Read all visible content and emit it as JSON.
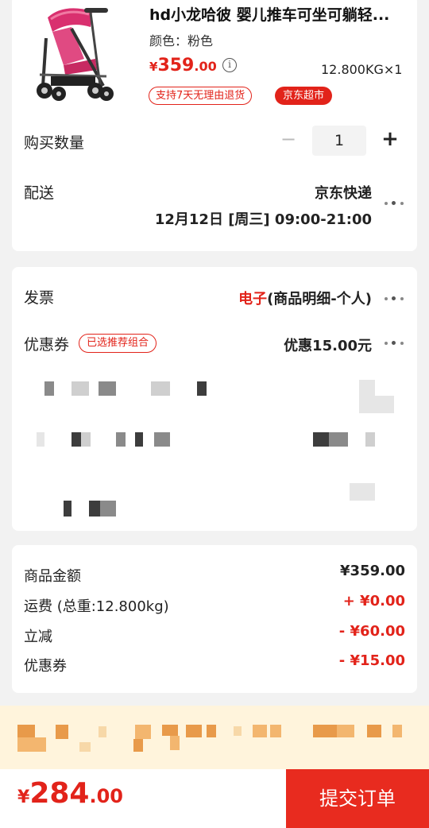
{
  "product": {
    "title": "hd小龙哈彼 婴儿推车可坐可躺轻...",
    "spec": "颜色：粉色",
    "price_currency": "¥",
    "price_int": "359",
    "price_dec": ".00",
    "weight": "12.800KG×1",
    "tag_return": "支持7天无理由退货",
    "tag_store": "京东超市",
    "image_icon": "stroller-image",
    "colors": {
      "frame": "#d9306f",
      "accent": "#e2231a"
    }
  },
  "quantity": {
    "label": "购买数量",
    "minus": "−",
    "value": "1",
    "plus": "+"
  },
  "delivery": {
    "label": "配送",
    "carrier": "京东快递",
    "time": "12月12日 [周三] 09:00-21:00"
  },
  "invoice": {
    "label": "发票",
    "type_red": "电子",
    "type_rest": "(商品明细-个人)"
  },
  "coupon": {
    "label": "优惠券",
    "tag": "已选推荐组合",
    "value": "优惠15.00元"
  },
  "summary": {
    "items": [
      {
        "label": "商品金额",
        "value": "¥359.00",
        "color": "#222222"
      },
      {
        "label": "运费 (总重:12.800kg)",
        "value": "+ ¥0.00",
        "color": "#e2231a"
      },
      {
        "label": "立减",
        "value": "- ¥60.00",
        "color": "#e2231a"
      },
      {
        "label": "优惠券",
        "value": "- ¥15.00",
        "color": "#e2231a"
      }
    ]
  },
  "footer": {
    "total_currency": "¥",
    "total_int": "284",
    "total_dec": ".00",
    "submit_label": "提交订单",
    "submit_color": "#e82b1f"
  }
}
